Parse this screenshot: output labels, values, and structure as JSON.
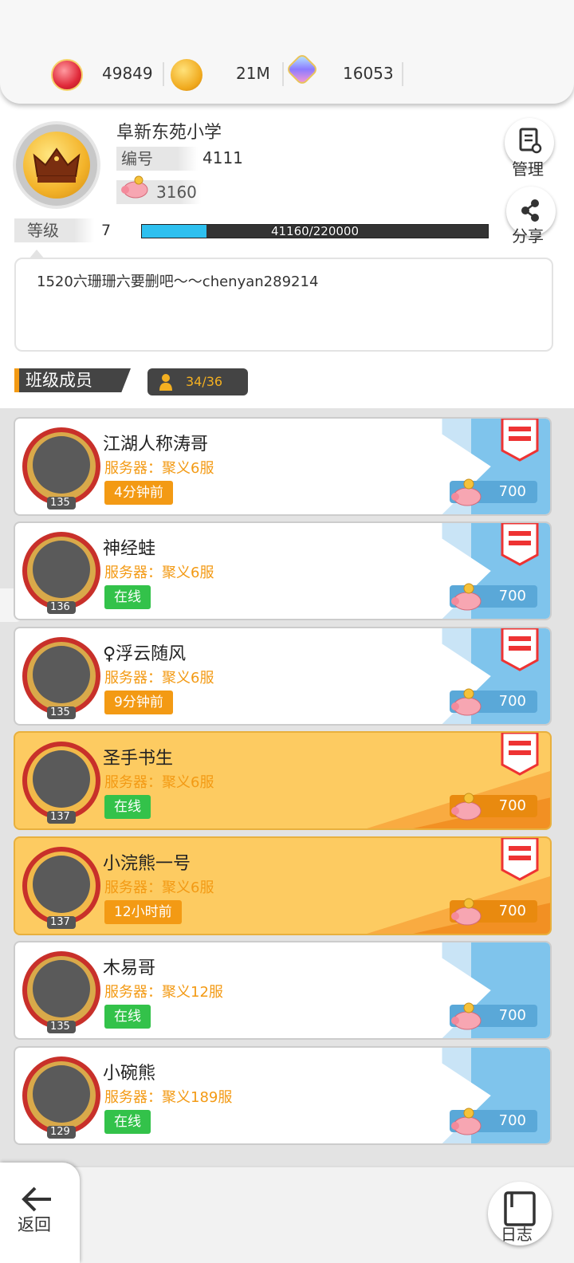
{
  "resources": {
    "gem": {
      "value": "49849",
      "icon": "red-gem-icon"
    },
    "gold": {
      "value": "21M",
      "icon": "gold-coin-icon"
    },
    "crystal": {
      "value": "16053",
      "icon": "crystal-icon"
    }
  },
  "school": {
    "name": "阜新东苑小学",
    "id_label": "编号",
    "id_value": "4111",
    "piggy_value": "3160",
    "level_label": "等级",
    "level_value": "7",
    "xp_text": "41160/220000",
    "xp_fraction": 0.187
  },
  "side_buttons": {
    "manage_label": "管理",
    "share_label": "分享"
  },
  "announcement": "1520六珊珊六要删吧～～chenyan289214",
  "members_section": {
    "title": "班级成员",
    "count": "34/36"
  },
  "members": [
    {
      "name": "江湖人称涛哥",
      "server": "服务器：聚义6服",
      "status": "4分钟前",
      "online": false,
      "level": "135",
      "score": "700",
      "gold": false
    },
    {
      "name": "神经蛙",
      "server": "服务器：聚义6服",
      "status": "在线",
      "online": true,
      "level": "136",
      "score": "700",
      "gold": false
    },
    {
      "name": "♀浮云随风",
      "server": "服务器：聚义6服",
      "status": "9分钟前",
      "online": false,
      "level": "135",
      "score": "700",
      "gold": false
    },
    {
      "name": "圣手书生",
      "server": "服务器：聚义6服",
      "status": "在线",
      "online": true,
      "level": "137",
      "score": "700",
      "gold": true
    },
    {
      "name": "小浣熊一号",
      "server": "服务器：聚义6服",
      "status": "12小时前",
      "online": false,
      "level": "137",
      "score": "700",
      "gold": true
    },
    {
      "name": "木易哥",
      "server": "服务器：聚义12服",
      "status": "在线",
      "online": true,
      "level": "135",
      "score": "700",
      "gold": false
    },
    {
      "name": "小碗熊",
      "server": "服务器：聚义189服",
      "status": "在线",
      "online": true,
      "level": "129",
      "score": "700",
      "gold": false
    }
  ],
  "bottom": {
    "back_label": "返回",
    "log_label": "日志"
  },
  "colors": {
    "accent_orange": "#f39a14",
    "online_green": "#33c24a",
    "xp_blue": "#2ec0ef"
  }
}
